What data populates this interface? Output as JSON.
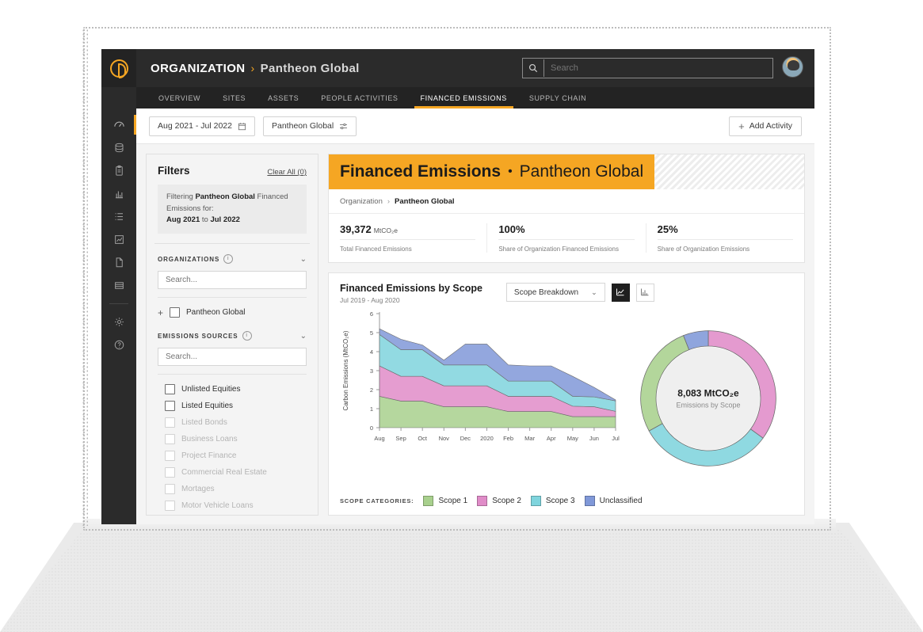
{
  "topbar": {
    "brand_prefix": "ORGANIZATION",
    "brand_separator": "›",
    "brand_org": "Pantheon Global",
    "search_placeholder": "Search",
    "logo_name": "app-logo"
  },
  "nav": {
    "tabs": [
      {
        "label": "OVERVIEW",
        "active": false
      },
      {
        "label": "SITES",
        "active": false
      },
      {
        "label": "ASSETS",
        "active": false
      },
      {
        "label": "PEOPLE ACTIVITIES",
        "active": false
      },
      {
        "label": "FINANCED EMISSIONS",
        "active": true
      },
      {
        "label": "SUPPLY CHAIN",
        "active": false
      }
    ]
  },
  "rail": {
    "items": [
      {
        "icon": "dashboard-icon",
        "active": true
      },
      {
        "icon": "database-icon",
        "active": false
      },
      {
        "icon": "clipboard-icon",
        "active": false
      },
      {
        "icon": "bar-chart-icon",
        "active": false
      },
      {
        "icon": "list-icon",
        "active": false
      },
      {
        "icon": "line-chart-icon",
        "active": false
      },
      {
        "icon": "document-icon",
        "active": false
      },
      {
        "icon": "table-icon",
        "active": false
      }
    ],
    "bottom_items": [
      {
        "icon": "gear-icon"
      },
      {
        "icon": "help-icon"
      }
    ]
  },
  "toolbar": {
    "date_pill": "Aug 2021 - Jul 2022",
    "org_pill": "Pantheon Global",
    "add_activity": "Add Activity",
    "add_plus": "+"
  },
  "filters": {
    "title": "Filters",
    "clear_all": "Clear All (0)",
    "note": {
      "line1_pre": "Filtering ",
      "line1_org": "Pantheon Global",
      "line1_post": " Financed Emissions for:",
      "line2_from": "Aug 2021",
      "line2_mid": " to ",
      "line2_to": "Jul 2022"
    },
    "organizations": {
      "label": "ORGANIZATIONS",
      "search_placeholder": "Search...",
      "items": [
        {
          "label": "Pantheon Global",
          "checked": false,
          "expandable": true
        }
      ]
    },
    "emissions_sources": {
      "label": "EMISSIONS SOURCES",
      "search_placeholder": "Search...",
      "items": [
        {
          "label": "Unlisted Equities",
          "disabled": false
        },
        {
          "label": "Listed Equities",
          "disabled": false
        },
        {
          "label": "Listed Bonds",
          "disabled": true
        },
        {
          "label": "Business Loans",
          "disabled": true
        },
        {
          "label": "Project Finance",
          "disabled": true
        },
        {
          "label": "Commercial Real Estate",
          "disabled": true
        },
        {
          "label": "Mortages",
          "disabled": true
        },
        {
          "label": "Motor Vehicle Loans",
          "disabled": true
        }
      ]
    }
  },
  "hero": {
    "title_bold": "Financed Emissions",
    "title_dot": "•",
    "title_light": "Pantheon Global",
    "breadcrumb_root": "Organization",
    "breadcrumb_arrow": "›",
    "breadcrumb_leaf": "Pantheon Global",
    "metrics": [
      {
        "value": "39,372",
        "unit": "MtCO₂e",
        "label": "Total Financed Emissions"
      },
      {
        "value": "100%",
        "unit": "",
        "label": "Share of Organization Financed Emissions"
      },
      {
        "value": "25%",
        "unit": "",
        "label": "Share of Organization Emissions"
      }
    ]
  },
  "chart_panel": {
    "title": "Financed Emissions by Scope",
    "subtitle": "Jul 2019 - Aug 2020",
    "dropdown_value": "Scope Breakdown",
    "dropdown_caret": "⌄",
    "toggle_line": "line-chart-toggle",
    "toggle_bar": "bar-chart-toggle",
    "legend_label": "SCOPE CATEGORIES:"
  },
  "chart_data": [
    {
      "type": "area",
      "title": "Financed Emissions by Scope",
      "subtitle": "Jul 2019 - Aug 2020",
      "xlabel": "",
      "ylabel": "Carbon Emissions (MtCO₂e)",
      "ylim": [
        0,
        6
      ],
      "yticks": [
        0,
        1,
        2,
        3,
        4,
        5,
        6
      ],
      "grid": false,
      "stacked": true,
      "legend_position": "bottom",
      "categories": [
        "Aug",
        "Sep",
        "Oct",
        "Nov",
        "Dec",
        "2020",
        "Feb",
        "Mar",
        "Apr",
        "May",
        "Jun",
        "Jul"
      ],
      "series": [
        {
          "name": "Scope 1",
          "color": "#a8d08d",
          "values": [
            1.65,
            1.4,
            1.4,
            1.1,
            1.1,
            1.1,
            0.85,
            0.85,
            0.85,
            0.58,
            0.58,
            0.58
          ]
        },
        {
          "name": "Scope 2",
          "color": "#e08cc8",
          "values": [
            1.6,
            1.3,
            1.3,
            1.1,
            1.1,
            1.1,
            0.8,
            0.8,
            0.8,
            0.55,
            0.52,
            0.28
          ]
        },
        {
          "name": "Scope 3",
          "color": "#7fd4dd",
          "values": [
            1.65,
            1.4,
            1.4,
            1.1,
            1.1,
            1.1,
            0.8,
            0.8,
            0.8,
            0.52,
            0.52,
            0.55
          ]
        },
        {
          "name": "Unclassified",
          "color": "#8098d8",
          "values": [
            0.3,
            0.55,
            0.25,
            0.25,
            1.1,
            1.1,
            0.85,
            0.8,
            0.8,
            1.05,
            0.5,
            0.05
          ]
        }
      ]
    },
    {
      "type": "pie",
      "title": "Emissions by Scope",
      "center_value": "8,083 MtCO₂e",
      "center_label": "Emissions by Scope",
      "donut": true,
      "labels": [
        "Scope 2",
        "Scope 3",
        "Scope 1",
        "Unclassified"
      ],
      "values": [
        35,
        32,
        27,
        6
      ],
      "colors": [
        "#e08cc8",
        "#7fd4dd",
        "#a8d08d",
        "#8098d8"
      ]
    }
  ],
  "legend": [
    {
      "label": "Scope 1",
      "color": "#a8d08d"
    },
    {
      "label": "Scope 2",
      "color": "#e08cc8"
    },
    {
      "label": "Scope 3",
      "color": "#7fd4dd"
    },
    {
      "label": "Unclassified",
      "color": "#8098d8"
    }
  ]
}
